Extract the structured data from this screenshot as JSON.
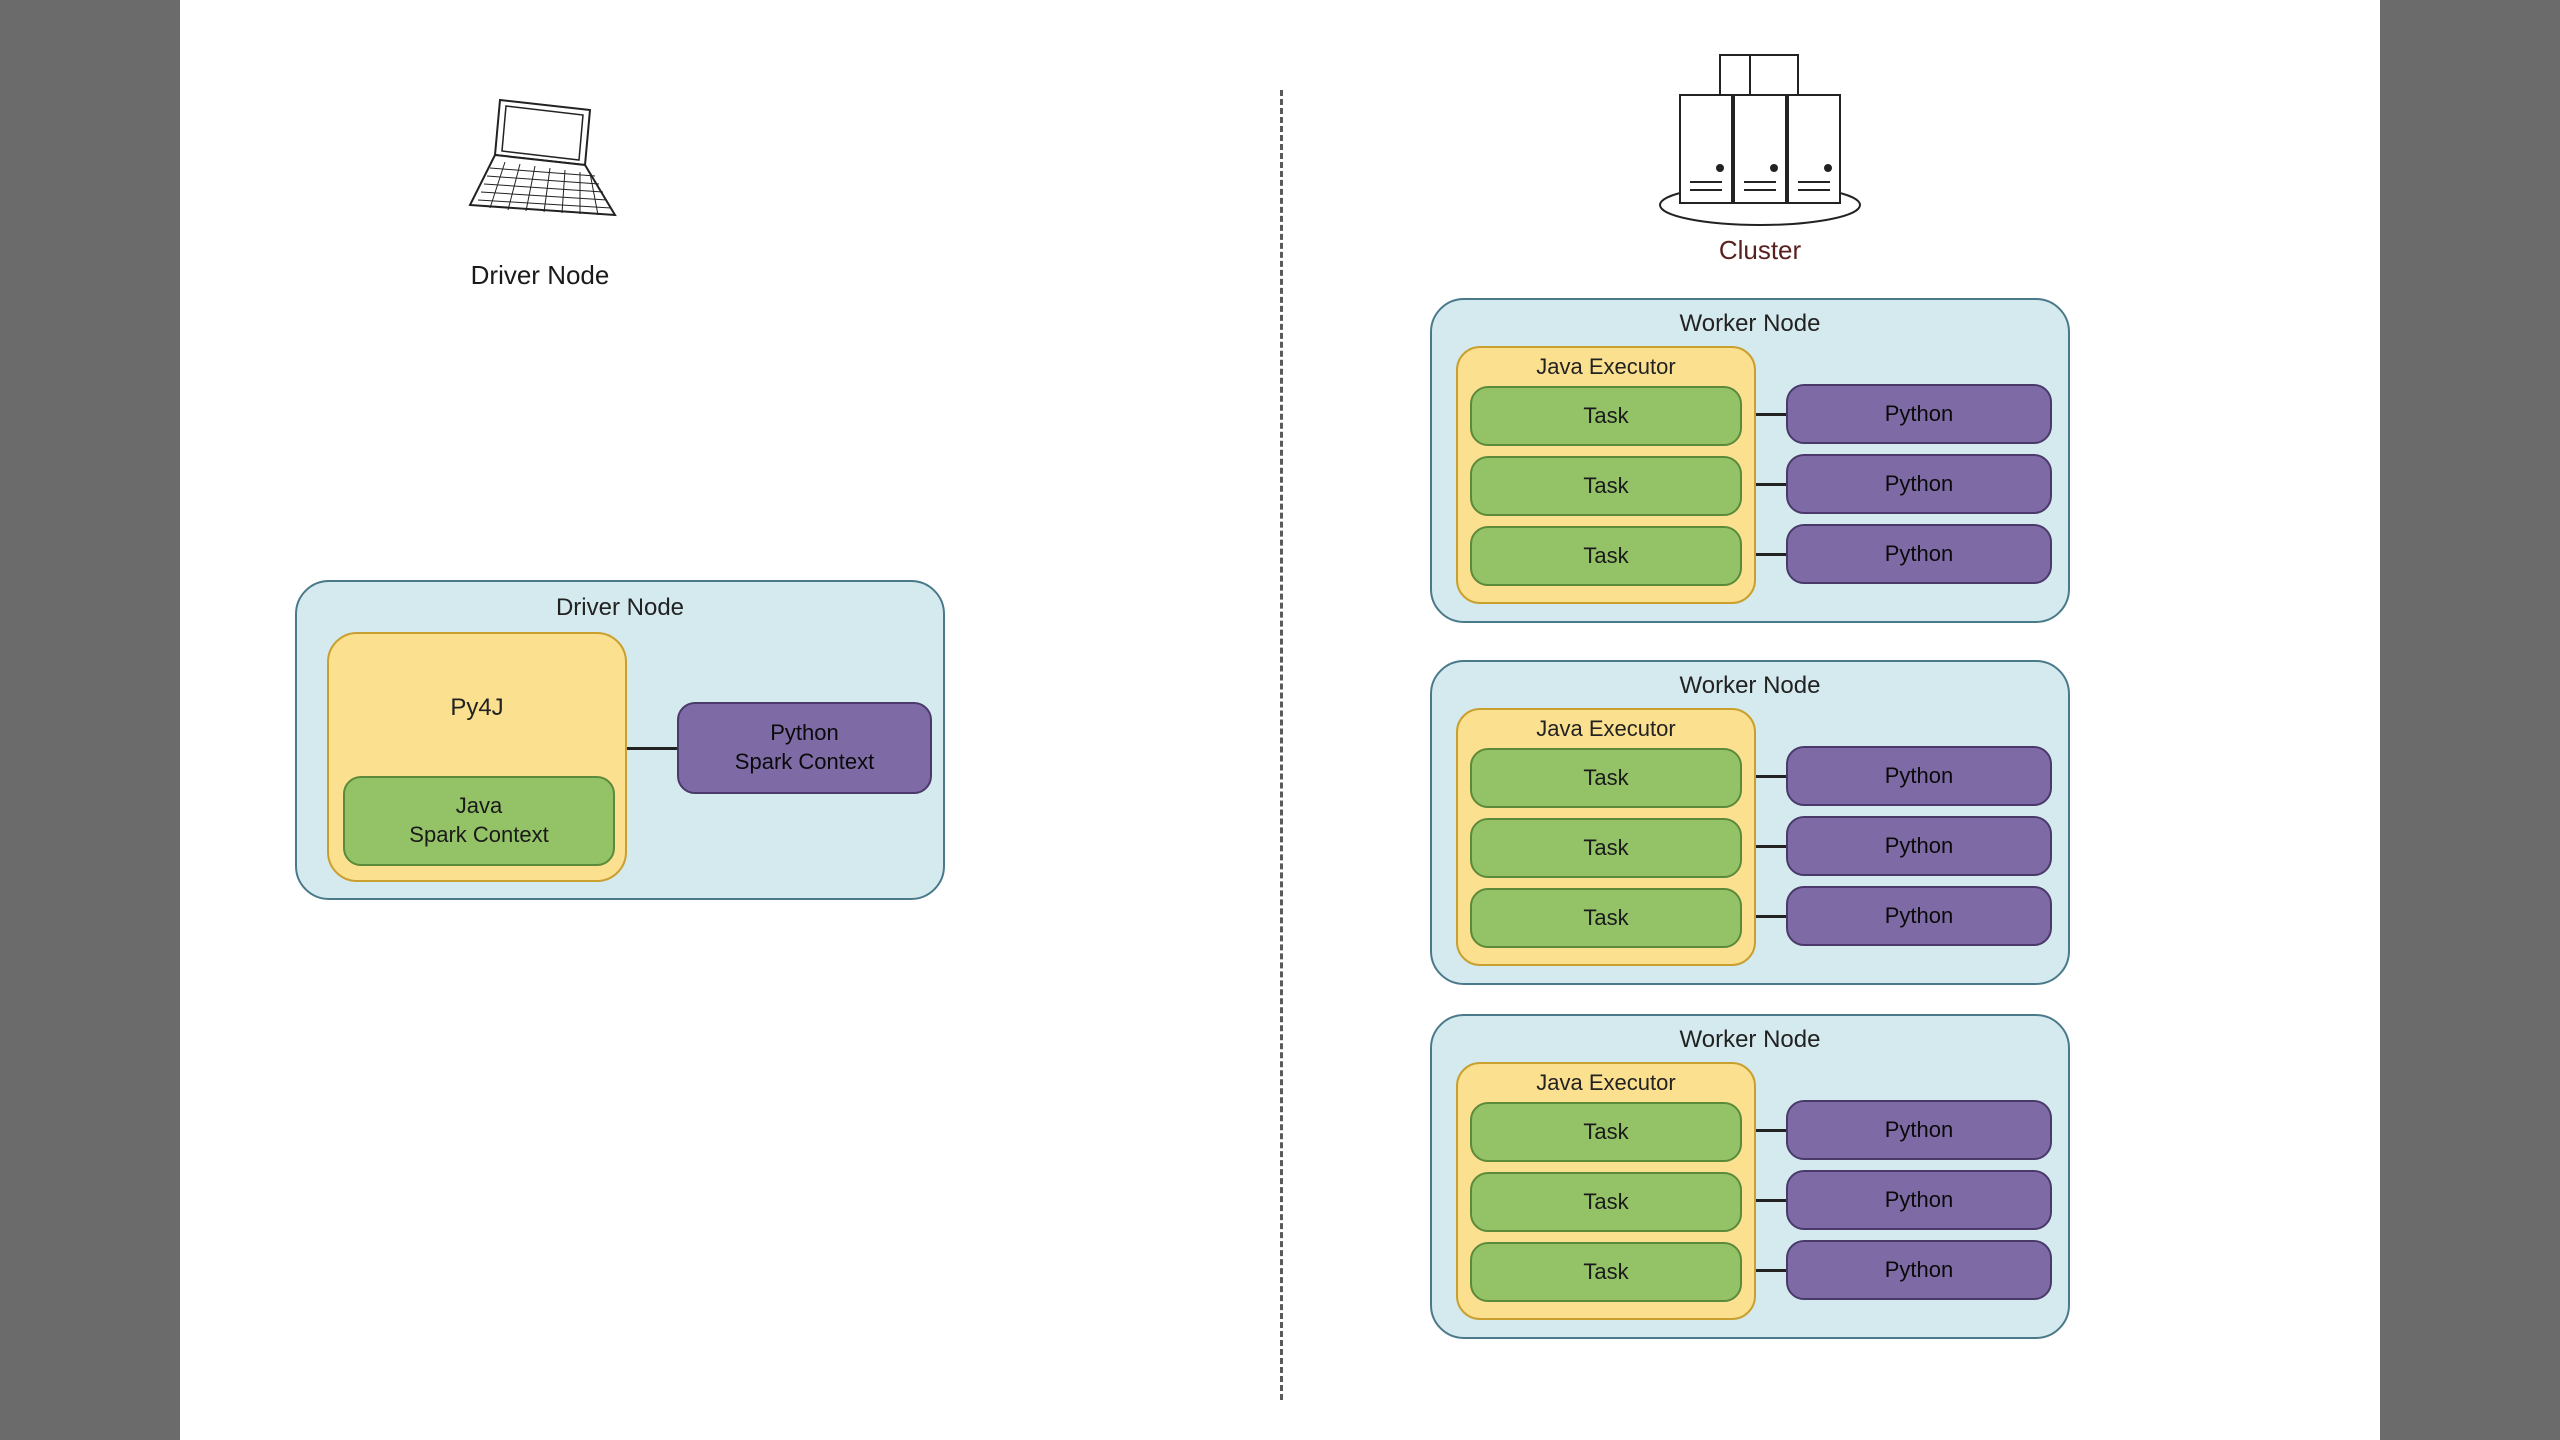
{
  "driver_section": {
    "icon_label": "Driver Node",
    "box_title": "Driver Node",
    "py4j_label": "Py4J",
    "java_sc_line1": "Java",
    "java_sc_line2": "Spark Context",
    "python_sc_line1": "Python",
    "python_sc_line2": "Spark Context"
  },
  "cluster_section": {
    "icon_label": "Cluster",
    "workers": [
      {
        "title": "Worker Node",
        "executor_title": "Java Executor",
        "tasks": [
          "Task",
          "Task",
          "Task"
        ],
        "pythons": [
          "Python",
          "Python",
          "Python"
        ]
      },
      {
        "title": "Worker Node",
        "executor_title": "Java Executor",
        "tasks": [
          "Task",
          "Task",
          "Task"
        ],
        "pythons": [
          "Python",
          "Python",
          "Python"
        ]
      },
      {
        "title": "Worker Node",
        "executor_title": "Java Executor",
        "tasks": [
          "Task",
          "Task",
          "Task"
        ],
        "pythons": [
          "Python",
          "Python",
          "Python"
        ]
      }
    ]
  }
}
